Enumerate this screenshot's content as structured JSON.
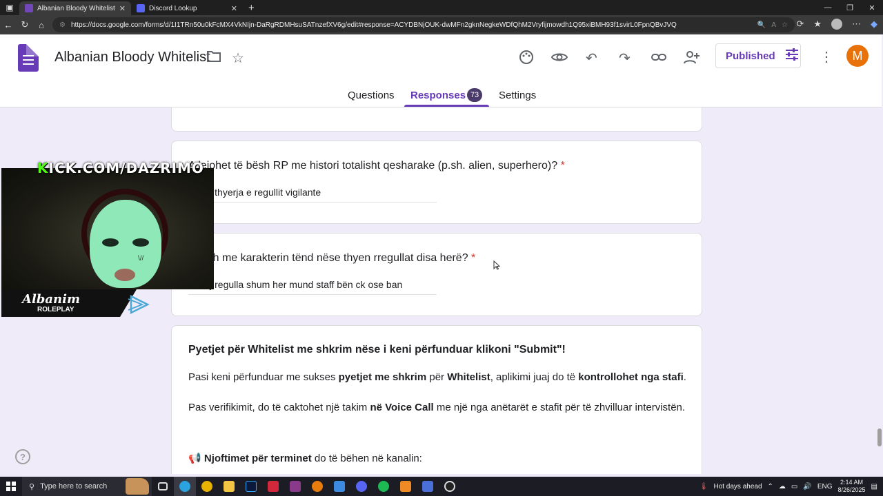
{
  "browser": {
    "tabs": [
      {
        "title": "Albanian Bloody Whitelist - Goog",
        "active": true,
        "color": "#7248b9"
      },
      {
        "title": "Discord Lookup",
        "active": false,
        "color": "#5865f2"
      }
    ],
    "url": "https://docs.google.com/forms/d/1I1TRn50u0kFcMX4VkNIjn-DaRgRDMHsuSATnzefXV6g/edit#response=ACYDBNjOUK-dwMFn2gknNegkeWDfQhM2Vryfijmowdh1Q95xiBMH93f1svirL0FpnQBvJVQ"
  },
  "form": {
    "title": "Albanian Bloody Whitelist",
    "published_label": "Published",
    "avatar_letter": "M",
    "tabs": {
      "questions": "Questions",
      "responses": "Responses",
      "responses_count": "73",
      "settings": "Settings"
    },
    "accent": "#673ab7"
  },
  "questions": [
    {
      "title": "A lejohet të bësh RP me histori totalisht qesharake (p.sh. alien, superhero)?",
      "required": "*",
      "answer": "posht thyerja e regullit vigilante"
    },
    {
      "title": "ndodh me karakterin tënd nëse thyen rregullat disa herë?",
      "required": "*",
      "answer": "e thej regulla shum her mund staff bën ck ose ban"
    }
  ],
  "info": {
    "heading": "Pyetjet për Whitelist me shkrim nëse i keni përfunduar klikoni \"Submit\"!",
    "p1": [
      "Pasi keni përfunduar me sukses ",
      "pyetjet me shkrim",
      " për ",
      "Whitelist",
      ", aplikimi juaj do të ",
      "kontrollohet nga stafi",
      "."
    ],
    "p2": [
      "Pas verifikimit, do të caktohet një takim ",
      "në Voice Call",
      " me një nga anëtarët e stafit për të zhvilluar intervistën."
    ],
    "p3_icon": "📢",
    "p3": [
      "Njoftimet për terminet",
      " do të bëhen në kanalin:"
    ]
  },
  "overlay": {
    "kick_k": "K",
    "kick_rest": "ICK.COM/DAZRIMO",
    "brand_main": "Albanim",
    "brand_sub": "ROLEPLAY",
    "mask_tag": "\\//"
  },
  "taskbar": {
    "search_placeholder": "Type here to search",
    "weather": "Hot days ahead",
    "lang": "ENG",
    "time": "2:14 AM",
    "date": "8/26/2025"
  }
}
